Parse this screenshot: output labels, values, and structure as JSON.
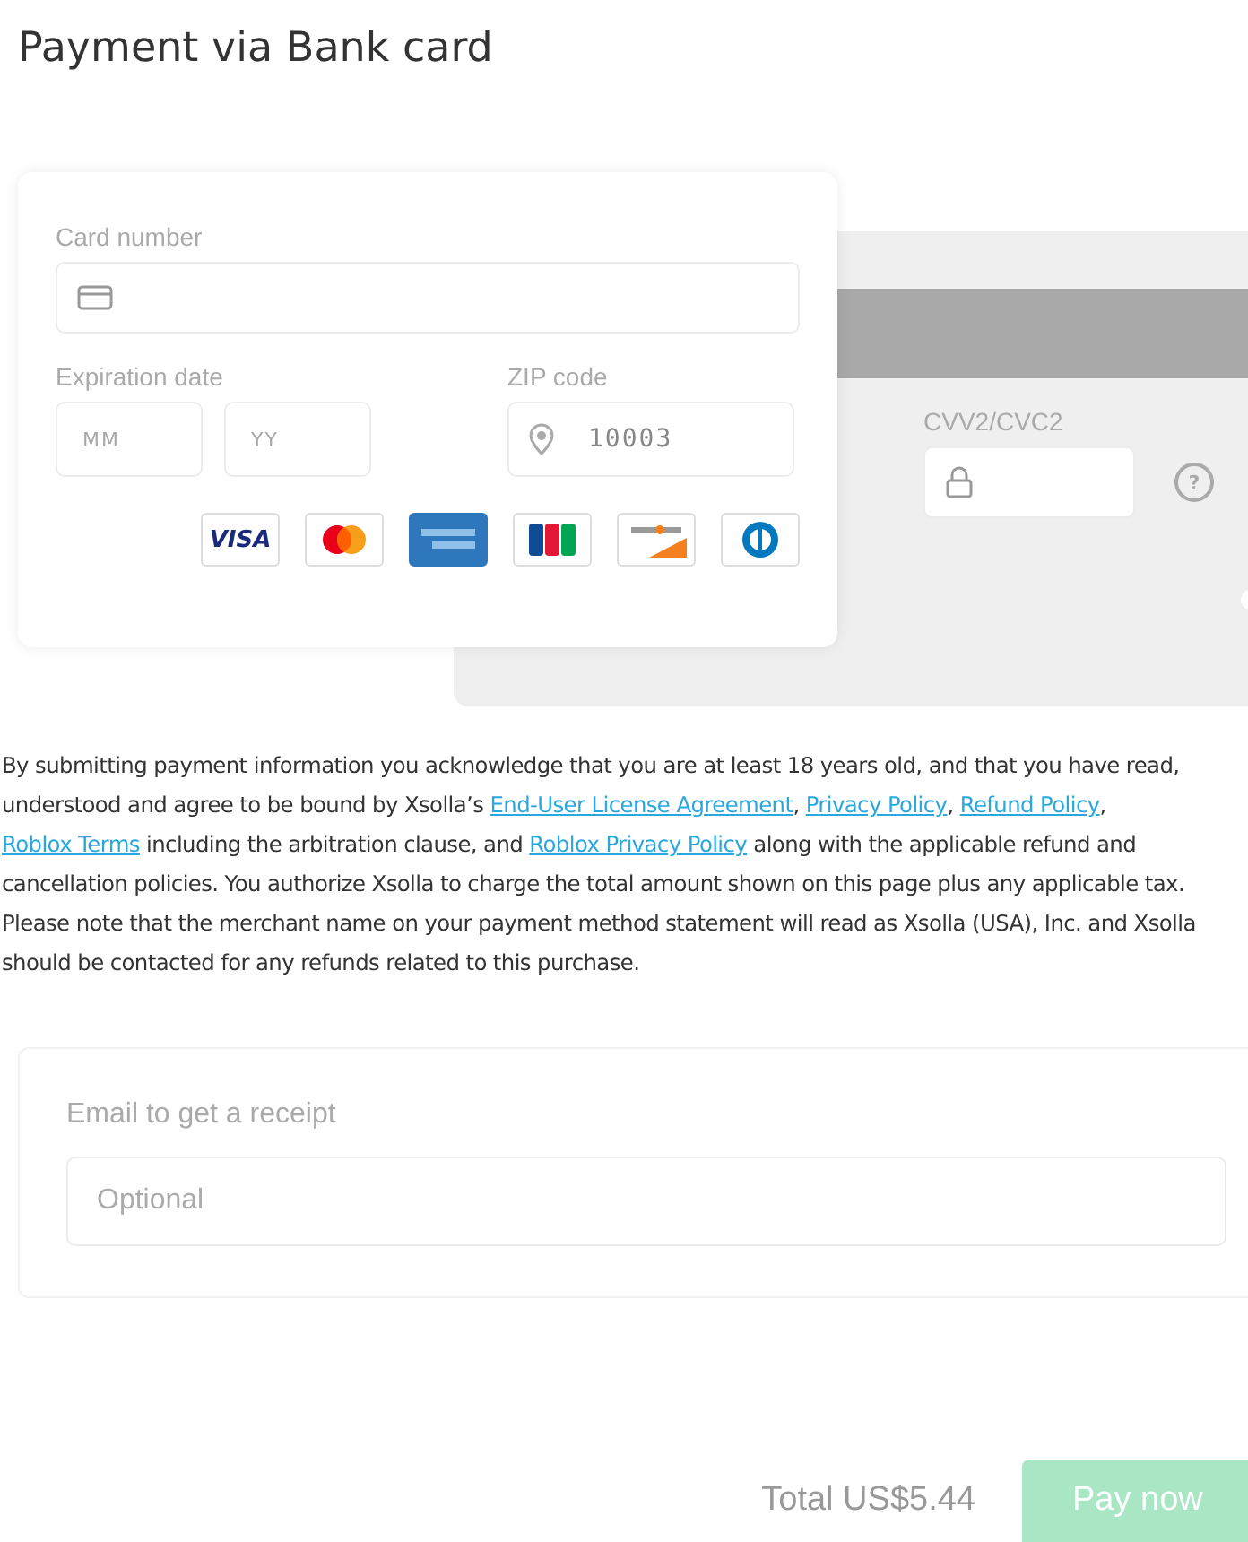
{
  "title": "Payment via Bank card",
  "card_front": {
    "card_number": {
      "label": "Card number"
    },
    "expiration": {
      "label": "Expiration date",
      "month_placeholder": "MM",
      "year_placeholder": "YY"
    },
    "zip": {
      "label": "ZIP code",
      "value": "10003"
    },
    "brands": [
      {
        "kind": "visa",
        "label": "VISA"
      },
      {
        "kind": "mastercard"
      },
      {
        "kind": "amex"
      },
      {
        "kind": "jcb"
      },
      {
        "kind": "discover"
      },
      {
        "kind": "diners"
      }
    ]
  },
  "card_back": {
    "cvv_label": "CVV2/CVC2",
    "help": "?"
  },
  "legal": {
    "parts": [
      {
        "kind": "text",
        "text": "By submitting payment information you acknowledge that you are at least 18 years old, and that you have read, understood and agree to be bound by Xsolla’s "
      },
      {
        "kind": "link",
        "text": "End-User License Agreement"
      },
      {
        "kind": "text",
        "text": ", "
      },
      {
        "kind": "link",
        "text": "Privacy Policy"
      },
      {
        "kind": "text",
        "text": ", "
      },
      {
        "kind": "link",
        "text": "Refund Policy"
      },
      {
        "kind": "text",
        "text": ", "
      },
      {
        "kind": "link",
        "text": "Roblox Terms"
      },
      {
        "kind": "text",
        "text": " including the arbitration clause, and "
      },
      {
        "kind": "link",
        "text": "Roblox Privacy Policy"
      },
      {
        "kind": "text",
        "text": " along with the applicable refund and cancellation policies. You authorize Xsolla to charge the total amount shown on this page plus any applicable tax. Please note that the merchant name on your payment method statement will read as Xsolla (USA), Inc. and Xsolla should be contacted for any refunds related to this purchase."
      }
    ]
  },
  "email": {
    "label": "Email to get a receipt",
    "placeholder": "Optional"
  },
  "footer": {
    "total": "Total US$5.44",
    "pay_button": {
      "label": "Pay now",
      "disabled": true
    }
  }
}
